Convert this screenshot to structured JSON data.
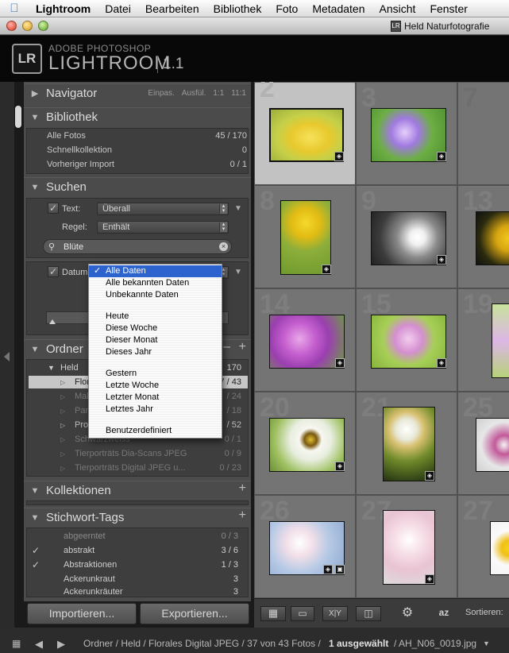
{
  "menubar": {
    "app": "Lightroom",
    "items": [
      "Datei",
      "Bearbeiten",
      "Bibliothek",
      "Foto",
      "Metadaten",
      "Ansicht",
      "Fenster"
    ]
  },
  "window": {
    "title": "Held Naturfotografie"
  },
  "identity": {
    "adobe": "ADOBE PHOTOSHOP",
    "name": "LIGHTROOM",
    "version": "1.1",
    "logo": "LR"
  },
  "navigator": {
    "title": "Navigator",
    "options": [
      "Einpas.",
      "Ausfül.",
      "1:1",
      "11:1"
    ]
  },
  "library": {
    "title": "Bibliothek",
    "rows": [
      {
        "label": "Alle Fotos",
        "value": "45 / 170"
      },
      {
        "label": "Schnellkollektion",
        "value": "0"
      },
      {
        "label": "Vorheriger Import",
        "value": "0 / 1"
      }
    ]
  },
  "search": {
    "title": "Suchen",
    "text_label": "Text:",
    "text_value": "Überall",
    "rule_label": "Regel:",
    "rule_value": "Enthält",
    "query": "Blüte",
    "date_label": "Datum"
  },
  "folders": {
    "title": "Ordner",
    "parent": {
      "label": "Held",
      "count": "170"
    },
    "rows": [
      {
        "label": "Florales Digital JPEG",
        "value": "37 / 43"
      },
      {
        "label": "Makro Digital JPEG",
        "value": "/ 24"
      },
      {
        "label": "Panorama JPEG",
        "value": "/ 18"
      },
      {
        "label": "Produktfotos",
        "value": "/ 52"
      },
      {
        "label": "Schwarzweiss",
        "value": "0 / 1"
      },
      {
        "label": "Tierporträts Dia-Scans JPEG",
        "value": "0 / 9"
      },
      {
        "label": "Tierporträts Digital JPEG u...",
        "value": "0 / 23"
      }
    ]
  },
  "collections": {
    "title": "Kollektionen"
  },
  "keywords": {
    "title": "Stichwort-Tags",
    "rows": [
      {
        "label": "abgeerntet",
        "value": "0 / 3",
        "checked": false
      },
      {
        "label": "abstrakt",
        "value": "3 / 6",
        "checked": true
      },
      {
        "label": "Abstraktionen",
        "value": "1 / 3",
        "checked": true
      },
      {
        "label": "Ackerunkraut",
        "value": "3",
        "checked": false
      },
      {
        "label": "Ackerunkräuter",
        "value": "3",
        "checked": false
      }
    ]
  },
  "buttons": {
    "import": "Importieren...",
    "export": "Exportieren..."
  },
  "date_menu": {
    "items": [
      "Alle Daten",
      "Alle bekannten Daten",
      "Unbekannte Daten",
      "Heute",
      "Diese Woche",
      "Dieser Monat",
      "Dieses Jahr",
      "Gestern",
      "Letzte Woche",
      "Letzter Monat",
      "Letztes Jahr",
      "Benutzerdefiniert"
    ],
    "selected": "Alle Daten"
  },
  "grid": {
    "cell_numbers": [
      "2",
      "3",
      "7",
      "8",
      "9",
      "13",
      "14",
      "15",
      "19",
      "20",
      "21",
      "25",
      "26",
      "27"
    ]
  },
  "toolbar": {
    "sort_label": "Sortieren:",
    "xy_label": "X|Y",
    "az_label": "az"
  },
  "statusbar": {
    "path": "Ordner / Held / Florales Digital JPEG / 37 von 43 Fotos /",
    "selected": "1 ausgewählt",
    "file": "/ AH_N06_0019.jpg"
  },
  "colors": {
    "menu_highlight": "#2c63cf",
    "panel": "#4b4b4b",
    "grid": "#5e5e5e"
  }
}
